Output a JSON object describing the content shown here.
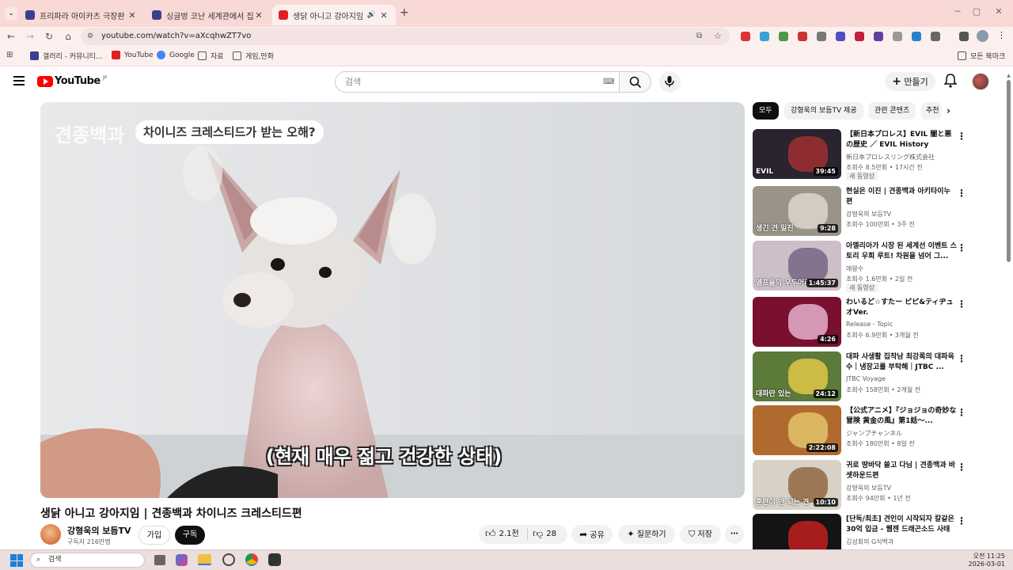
{
  "browser": {
    "tabs": [
      {
        "title": "프리파라 아이카츠 극장판 후기",
        "active": false
      },
      {
        "title": "싱글벙 코난 세계관에서 집주인",
        "active": false
      },
      {
        "title": "생닭 아니고 강아지임 | 견종",
        "active": true
      }
    ],
    "url": "youtube.com/watch?v=aXcqhwZT7vo",
    "bookmarks": [
      "갤러리 - 커뮤니티...",
      "YouTube",
      "Google",
      "자료",
      "게임,만화"
    ],
    "all_bookmarks": "모든 북마크"
  },
  "youtube": {
    "logo_text": "YouTube",
    "region": "JP",
    "search_placeholder": "검색",
    "create_label": "만들기"
  },
  "video": {
    "overlay_brand": "견종백과",
    "overlay_title": "차이니즈 크레스티드가 받는 오해?",
    "subtitle": "(현재 매우 젊고 건강한 상태)",
    "title": "생닭 아니고 강아지임 | 견종백과 차이니즈 크레스티드편",
    "channel": "강형욱의 보듬TV",
    "subscribers": "구독자 216만명",
    "join_label": "가입",
    "subscribe_label": "구독",
    "likes": "2.1천",
    "dislikes": "28",
    "share_label": "공유",
    "ask_label": "질문하기",
    "save_label": "저장"
  },
  "chips": [
    "모두",
    "강형욱의 보듬TV 제공",
    "관련 콘텐츠",
    "추천"
  ],
  "recommendations": [
    {
      "title": "【新日本プロレス】EVIL 闇と悪の歴史 ／ EVIL History 2015-...",
      "channel": "新日本プロレスリング株式会社",
      "meta": "조회수 8.5만회 • 17시간 전",
      "badge": "새 동영상",
      "duration": "39:45",
      "thumb_color": "#2a2430",
      "accent": "#b03030",
      "thumb_text": "EVIL"
    },
    {
      "title": "현실은 이진 | 견종백과 아키타이누편",
      "channel": "강형욱의 보듬TV",
      "meta": "조회수 100만회 • 3주 전",
      "badge": "",
      "duration": "9:28",
      "thumb_color": "#9a9488",
      "accent": "#e6e0d4",
      "thumb_text": "생긴 견 일진"
    },
    {
      "title": "아멜리아가 시장 된 세계선 이벤트 스토리 우회 루트! 차원을 넘어 그...",
      "channel": "애왕수",
      "meta": "조회수 1.6만회 • 2일 전",
      "badge": "새 동영상",
      "duration": "1:45:37",
      "thumb_color": "#cdbfc8",
      "accent": "#6b5a78",
      "thumb_text": "엘프들의 우두머리"
    },
    {
      "title": "わいるど☆すたー ピピ&ティヂュオVer.",
      "channel": "Release - Topic",
      "meta": "조회수 6.9만회 • 3개월 전",
      "badge": "",
      "duration": "4:26",
      "thumb_color": "#7a1030",
      "accent": "#f3c6e0",
      "thumb_text": ""
    },
    {
      "title": "대파 사생활 집착남 최강록의 대파육수｜냉장고를 부탁해｜JTBC ...",
      "channel": "JTBC Voyage",
      "meta": "조회수 158만회 • 2개월 전",
      "badge": "",
      "duration": "24:12",
      "thumb_color": "#5c7a3a",
      "accent": "#f2d24a",
      "thumb_text": "대파만 있는"
    },
    {
      "title": "【公式アニメ】『ジョジョの奇妙な冒険 黄金の風』第1話〜...",
      "channel": "ジャンプチャンネル",
      "meta": "조회수 180만회 • 8일 전",
      "badge": "",
      "duration": "2:22:08",
      "thumb_color": "#b06a30",
      "accent": "#e8d070",
      "thumb_text": ""
    },
    {
      "title": "귀로 땅바닥 쓸고 다님 | 견종백과 바셋하운드편",
      "channel": "강형욱의 보듬TV",
      "meta": "조회수 94만회 • 1년 전",
      "badge": "",
      "duration": "10:10",
      "thumb_color": "#d8d2c6",
      "accent": "#8a5a30",
      "thumb_text": "훈련이 안 되는 견"
    },
    {
      "title": "[단독/최초] 견인이 시작되자 칼같은 30억 입금 - 웹젠 드래곤소드 사태",
      "channel": "김성회의 G식백과",
      "meta": "",
      "badge": "",
      "duration": "",
      "thumb_color": "#141414",
      "accent": "#d82020",
      "thumb_text": "WEBZEN"
    }
  ],
  "taskbar": {
    "search_placeholder": "검색",
    "time": "오전 11:25",
    "date": "2026-03-01"
  }
}
